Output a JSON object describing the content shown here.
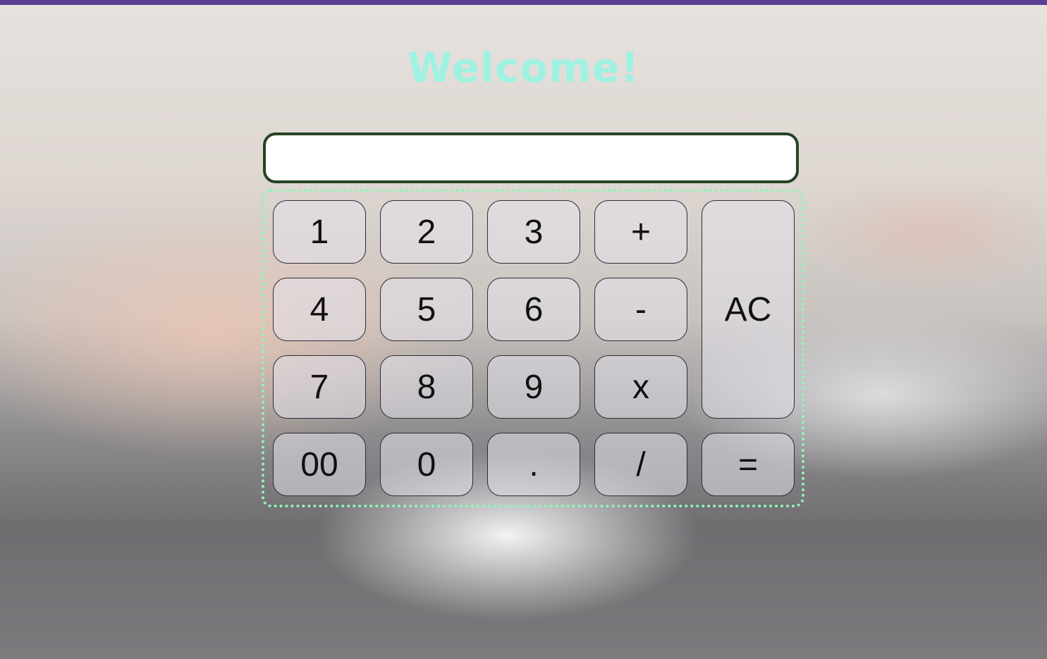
{
  "header": {
    "title": "Welcome!"
  },
  "display": {
    "value": ""
  },
  "keypad": {
    "row1": [
      "1",
      "2",
      "3",
      "+"
    ],
    "row2": [
      "4",
      "5",
      "6",
      "-"
    ],
    "row3": [
      "7",
      "8",
      "9",
      "x"
    ],
    "row4": [
      "00",
      "0",
      ".",
      "/",
      "="
    ],
    "clear_label": "AC"
  },
  "colors": {
    "accent_bar": "#5b3f93",
    "title": "#9ff2e2",
    "display_border": "#244424",
    "keypad_border": "#8ff5b8"
  }
}
